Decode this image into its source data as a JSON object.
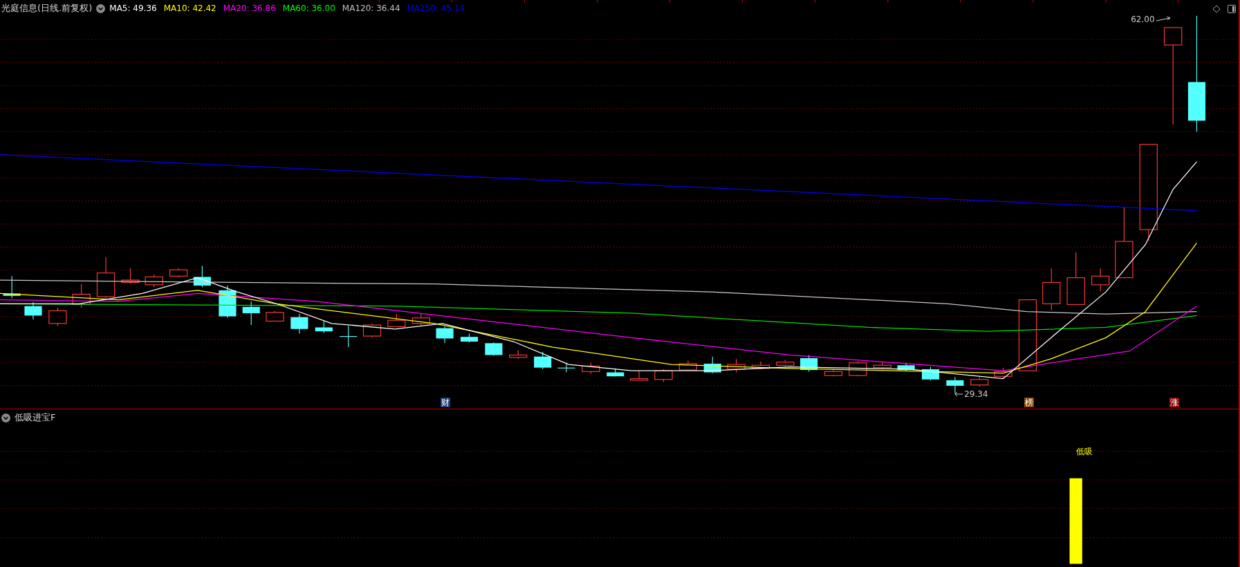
{
  "chart_header": {
    "title": "光庭信息(日线.前复权)",
    "indicators": [
      {
        "label": "MA5: 49.36",
        "color": "#ffffff"
      },
      {
        "label": "MA10: 42.42",
        "color": "#ffff00"
      },
      {
        "label": "MA20: 36.86",
        "color": "#ff00ff"
      },
      {
        "label": "MA60: 36.00",
        "color": "#00ff00"
      },
      {
        "label": "MA120: 36.44",
        "color": "#c0c0c0"
      },
      {
        "label": "MA250: 45.14",
        "color": "#0000ff"
      }
    ]
  },
  "price_labels": {
    "high": "62.00",
    "low": "29.34"
  },
  "markers": [
    {
      "text": "财",
      "color": "#1c3f74"
    },
    {
      "text": "榜",
      "color": "#8a4a0c"
    },
    {
      "text": "涨",
      "color": "#8b0a0a"
    }
  ],
  "sub_panel": {
    "title": "低吸进宝F",
    "signal_label": "低吸"
  }
}
